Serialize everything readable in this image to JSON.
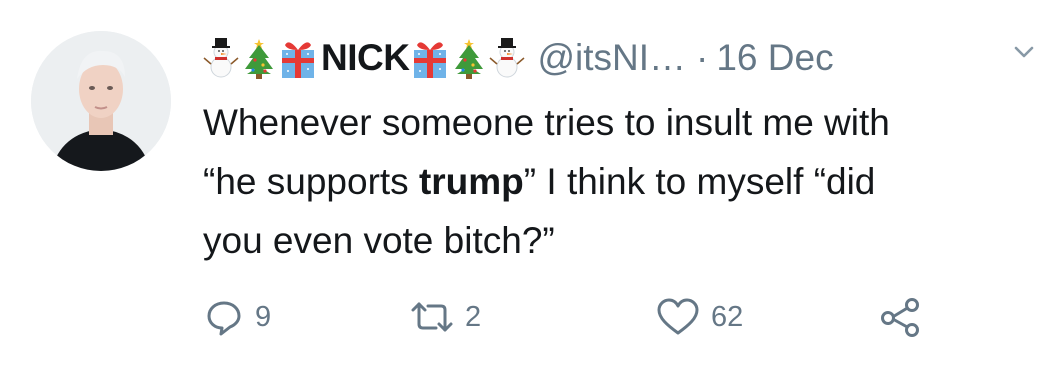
{
  "tweet": {
    "author": {
      "name": "NICK",
      "handle": "@itsNI…",
      "emoji_left": [
        "snowman-icon",
        "christmas-tree-icon",
        "gift-icon"
      ],
      "emoji_right": [
        "gift-icon",
        "christmas-tree-icon",
        "snowman-icon"
      ]
    },
    "separator": "·",
    "date": "16 Dec",
    "text": {
      "line1": "Whenever someone tries to insult me with",
      "line2_pre": "“he supports ",
      "line2_bold": "trump",
      "line2_post": "” I think to myself “did",
      "line3": "you even vote bitch?”"
    },
    "actions": {
      "reply_count": "9",
      "retweet_count": "2",
      "like_count": "62"
    }
  },
  "colors": {
    "text": "#14171a",
    "secondary": "#657786",
    "background": "#ffffff"
  }
}
